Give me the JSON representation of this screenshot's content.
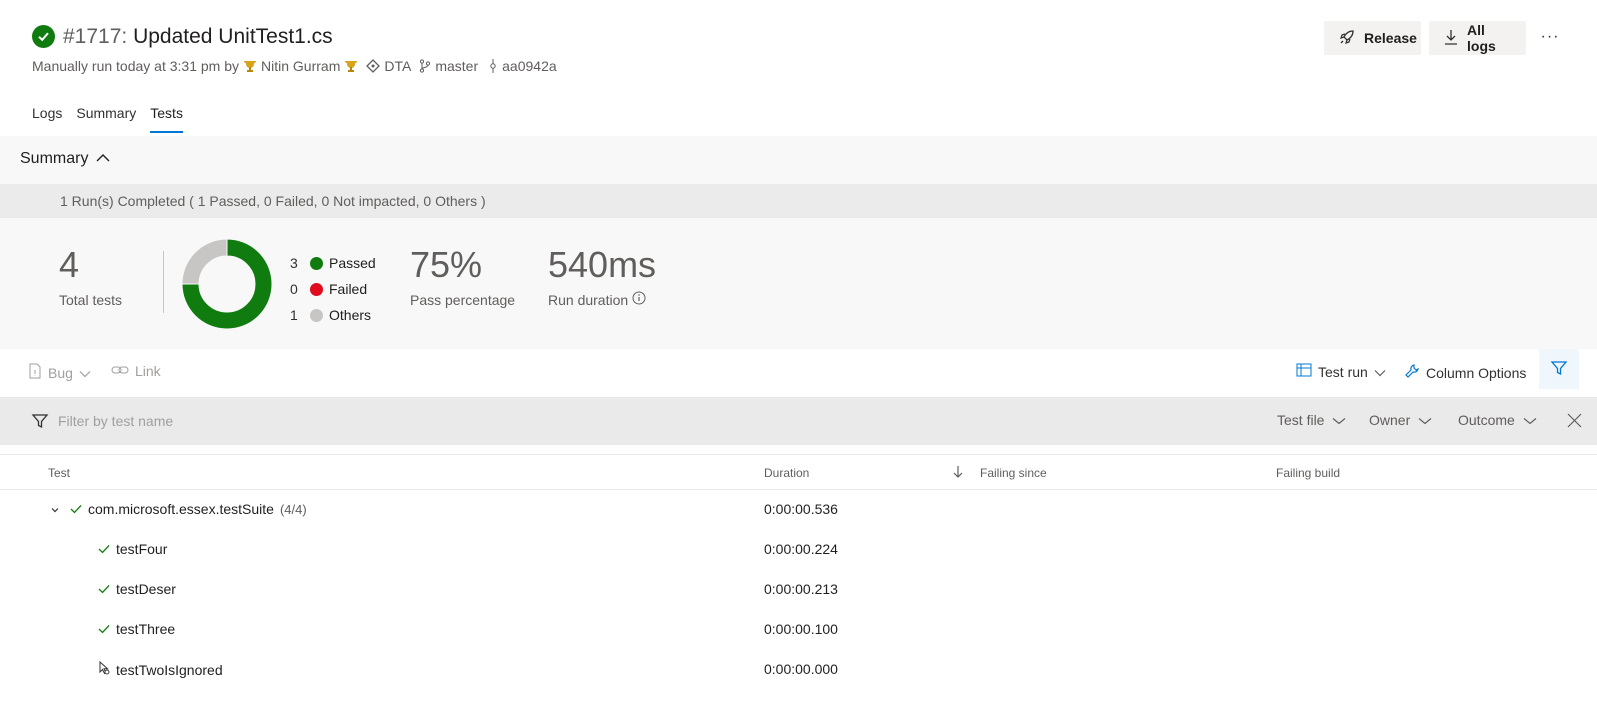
{
  "header": {
    "build_number": "#1717:",
    "title": "Updated UnitTest1.cs",
    "run_info": "Manually run today at 3:31 pm by",
    "user": "Nitin Gurram",
    "repo": "DTA",
    "branch": "master",
    "commit": "aa0942a",
    "release_label": "Release",
    "all_logs_label": "All logs",
    "more_label": "···"
  },
  "tabs": [
    {
      "label": "Logs"
    },
    {
      "label": "Summary"
    },
    {
      "label": "Tests",
      "active": true
    }
  ],
  "summary": {
    "title": "Summary",
    "run_status": "1 Run(s) Completed ( 1 Passed, 0 Failed, 0 Not impacted, 0 Others )",
    "total_tests": "4",
    "total_tests_label": "Total tests",
    "legend": [
      {
        "count": "3",
        "label": "Passed",
        "color": "#107c10",
        "value": 3
      },
      {
        "count": "0",
        "label": "Failed",
        "color": "#e00b1c",
        "value": 0
      },
      {
        "count": "1",
        "label": "Others",
        "color": "#c8c6c4",
        "value": 1
      }
    ],
    "pass_percentage": "75%",
    "pass_percentage_label": "Pass percentage",
    "run_duration": "540ms",
    "run_duration_label": "Run duration"
  },
  "toolbar": {
    "bug_label": "Bug",
    "link_label": "Link",
    "test_run_label": "Test run",
    "column_options_label": "Column Options"
  },
  "filter_bar": {
    "placeholder": "Filter by test name",
    "test_file_label": "Test file",
    "owner_label": "Owner",
    "outcome_label": "Outcome"
  },
  "table": {
    "headers": {
      "test": "Test",
      "duration": "Duration",
      "failing_since": "Failing since",
      "failing_build": "Failing build"
    },
    "suite": {
      "name": "com.microsoft.essex.testSuite",
      "count": "(4/4)",
      "duration": "0:00:00.536"
    },
    "rows": [
      {
        "name": "testFour",
        "duration": "0:00:00.224",
        "status": "passed"
      },
      {
        "name": "testDeser",
        "duration": "0:00:00.213",
        "status": "passed"
      },
      {
        "name": "testThree",
        "duration": "0:00:00.100",
        "status": "passed"
      },
      {
        "name": "testTwoIsIgnored",
        "duration": "0:00:00.000",
        "status": "ignored"
      }
    ]
  },
  "colors": {
    "accent": "#0078d4",
    "passed": "#107c10",
    "failed": "#e00b1c",
    "others": "#c8c6c4"
  }
}
